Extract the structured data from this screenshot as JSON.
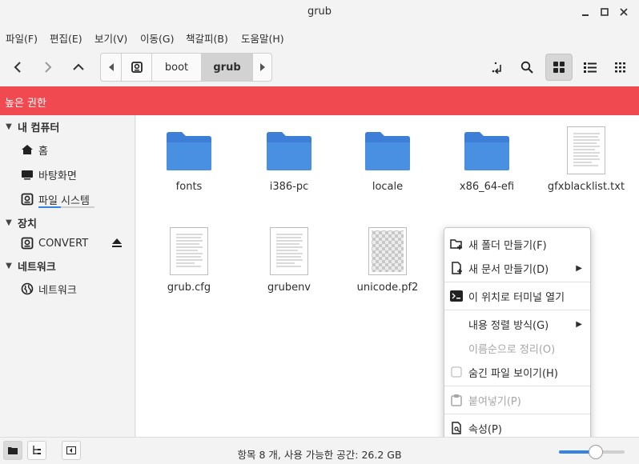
{
  "window": {
    "title": "grub"
  },
  "menubar": [
    "파일(F)",
    "편집(E)",
    "보기(V)",
    "이동(G)",
    "책갈피(B)",
    "도움말(H)"
  ],
  "breadcrumb": {
    "items": [
      "boot",
      "grub"
    ]
  },
  "banner": {
    "text": "높은 권한"
  },
  "sidebar": {
    "sections": [
      {
        "label": "내 컴퓨터",
        "items": [
          "홈",
          "바탕화면",
          "파일 시스템"
        ]
      },
      {
        "label": "장치",
        "items": [
          "CONVERT"
        ]
      },
      {
        "label": "네트워크",
        "items": [
          "네트워크"
        ]
      }
    ]
  },
  "files": [
    {
      "name": "fonts",
      "kind": "folder"
    },
    {
      "name": "i386-pc",
      "kind": "folder"
    },
    {
      "name": "locale",
      "kind": "folder"
    },
    {
      "name": "x86_64-efi",
      "kind": "folder"
    },
    {
      "name": "gfxblacklist.txt",
      "kind": "text"
    },
    {
      "name": "grub.cfg",
      "kind": "text"
    },
    {
      "name": "grubenv",
      "kind": "text"
    },
    {
      "name": "unicode.pf2",
      "kind": "binary"
    }
  ],
  "context_menu": {
    "items": [
      {
        "label": "새 폴더 만들기(F)",
        "icon": "new-folder-icon",
        "submenu": false,
        "disabled": false
      },
      {
        "label": "새 문서 만들기(D)",
        "icon": "new-document-icon",
        "submenu": true,
        "disabled": false
      },
      {
        "label": "이 위치로 터미널 열기",
        "icon": "terminal-icon",
        "submenu": false,
        "disabled": false
      },
      {
        "label": "내용 정렬 방식(G)",
        "icon": "",
        "submenu": true,
        "disabled": false
      },
      {
        "label": "이름순으로 정리(O)",
        "icon": "",
        "submenu": false,
        "disabled": true
      },
      {
        "label": "숨긴 파일 보이기(H)",
        "icon": "checkbox-icon",
        "submenu": false,
        "disabled": false
      },
      {
        "label": "붙여넣기(P)",
        "icon": "paste-icon",
        "submenu": false,
        "disabled": true
      },
      {
        "label": "속성(P)",
        "icon": "properties-icon",
        "submenu": false,
        "disabled": false
      }
    ]
  },
  "statusbar": {
    "text": "항목 8 개, 사용 가능한 공간: 26.2 GB",
    "zoom_fraction": 0.56
  },
  "colors": {
    "accent": "#3584e4",
    "banner": "#f04a50",
    "folder": "#4a90e2"
  }
}
